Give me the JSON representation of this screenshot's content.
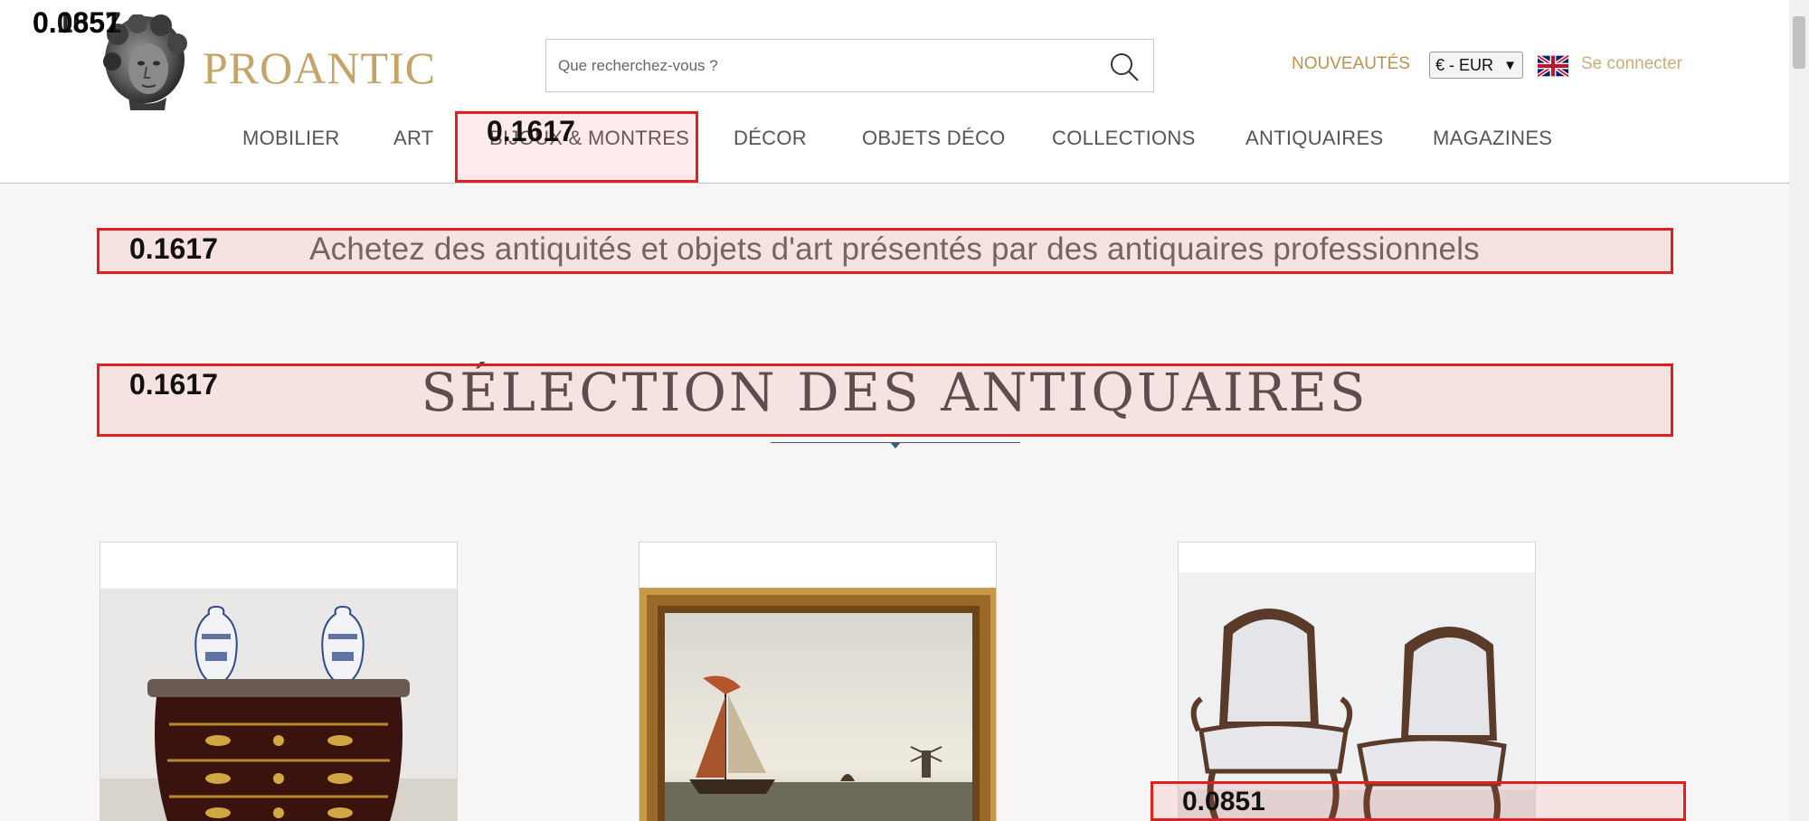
{
  "header": {
    "brand": "PROANTIC",
    "search_placeholder": "Que recherchez-vous ?",
    "new_label": "NOUVEAUTÉS",
    "currency": "€ - EUR",
    "language_flag": "uk-flag",
    "login_label": "Se connecter"
  },
  "nav": {
    "items": [
      {
        "label": "MOBILIER"
      },
      {
        "label": "ART"
      },
      {
        "label": "BIJOUX & MONTRES"
      },
      {
        "label": "DÉCOR"
      },
      {
        "label": "OBJETS DÉCO"
      },
      {
        "label": "COLLECTIONS"
      },
      {
        "label": "ANTIQUAIRES"
      },
      {
        "label": "MAGAZINES"
      }
    ]
  },
  "main": {
    "tagline": "Achetez des antiquités et objets d'art présentés par des antiquaires professionnels",
    "section_title": "SÉLECTION DES ANTIQUAIRES",
    "cards": [
      {
        "image": "commode-with-delft-vases"
      },
      {
        "image": "marine-painting-gilt-frame"
      },
      {
        "image": "pair-of-louis-xv-armchairs"
      }
    ]
  },
  "overlays": {
    "top_left_a": "0.1657",
    "top_left_b": "0.0851",
    "nav_box": "0.1617",
    "tagline_box": "0.1617",
    "title_box": "0.1617",
    "card_box": "0.0851"
  },
  "colors": {
    "brand_gold": "#c5a46a",
    "page_bg": "#f7f6f4",
    "overlay_red": "#e02020"
  }
}
